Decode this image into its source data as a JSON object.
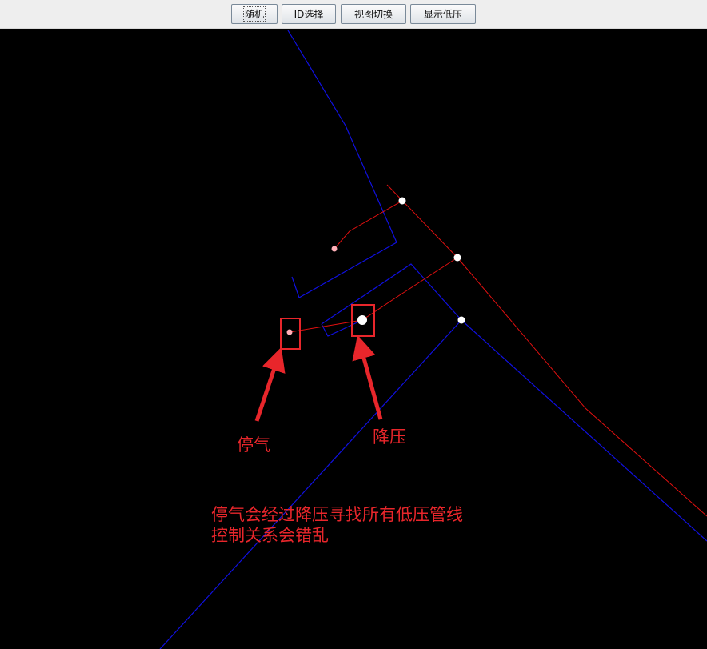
{
  "toolbar": {
    "buttons": [
      {
        "label": "随机"
      },
      {
        "label": "ID选择"
      },
      {
        "label": "视图切换"
      },
      {
        "label": "显示低压"
      }
    ]
  },
  "annotations": {
    "stop_gas_label": "停气",
    "pressure_reduce_label": "降压",
    "note_line_1": "停气会经过降压寻找所有低压管线",
    "note_line_2": "控制关系会错乱"
  },
  "colors": {
    "background": "#000000",
    "pipe_blue": "#1010e0",
    "pipe_red": "#e01010",
    "node_white": "#ffffff",
    "node_pink": "#ffb0b8",
    "annotation_red": "#e8262b",
    "toolbar_bg": "#eeeeee"
  }
}
